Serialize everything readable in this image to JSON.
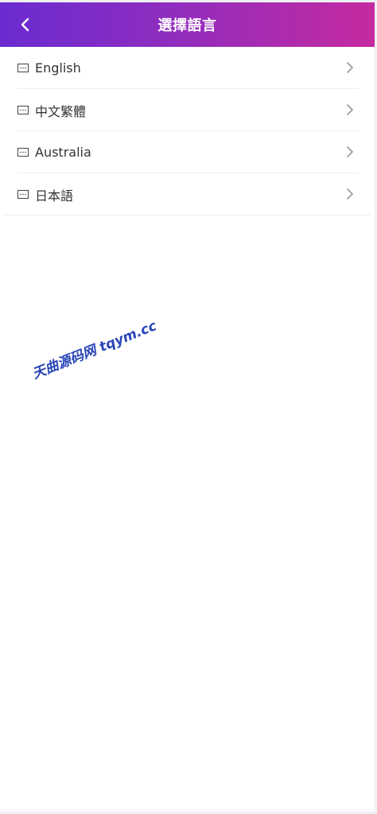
{
  "header": {
    "title": "選擇語言",
    "back_icon": "chevron-left-icon"
  },
  "languages": [
    {
      "label": "English",
      "icon": "language-icon"
    },
    {
      "label": "中文繁體",
      "icon": "language-icon"
    },
    {
      "label": "Australia",
      "icon": "language-icon"
    },
    {
      "label": "日本語",
      "icon": "language-icon"
    }
  ],
  "watermark": {
    "text": "天曲源码网 tqym.cc"
  },
  "colors": {
    "header_start": "#6a2bd0",
    "header_end": "#c52aa0",
    "watermark": "#2a46b8"
  }
}
